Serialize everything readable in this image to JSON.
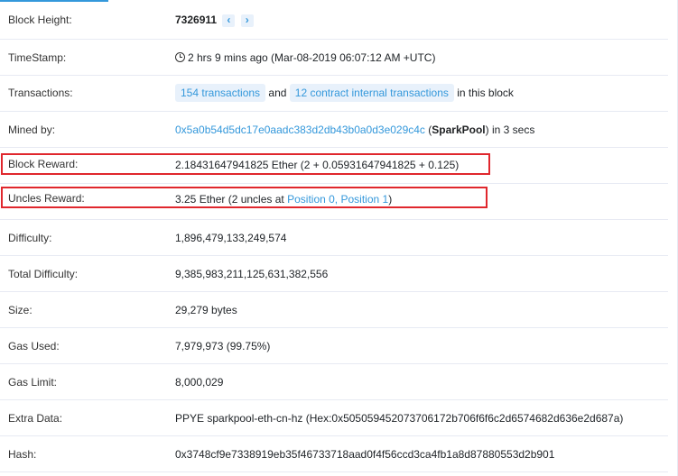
{
  "rows": {
    "block_height": {
      "label": "Block Height:",
      "value": "7326911"
    },
    "timestamp": {
      "label": "TimeStamp:",
      "value": "2 hrs 9 mins ago (Mar-08-2019 06:07:12 AM +UTC)"
    },
    "transactions": {
      "label": "Transactions:",
      "tx_badge": "154 transactions",
      "and": "and",
      "internal_badge": "12 contract internal transactions",
      "suffix": "in this block"
    },
    "mined_by": {
      "label": "Mined by:",
      "address": "0x5a0b54d5dc17e0aadc383d2db43b0a0d3e029c4c",
      "open_paren": "(",
      "pool": "SparkPool",
      "suffix": ") in 3 secs"
    },
    "block_reward": {
      "label": "Block Reward:",
      "value": "2.18431647941825 Ether (2 + 0.05931647941825 + 0.125)"
    },
    "uncles_reward": {
      "label": "Uncles Reward:",
      "prefix": "3.25 Ether (2 uncles at",
      "pos0": "Position 0,",
      "pos1": "Position 1",
      "suffix": ")"
    },
    "difficulty": {
      "label": "Difficulty:",
      "value": "1,896,479,133,249,574"
    },
    "total_difficulty": {
      "label": "Total Difficulty:",
      "value": "9,385,983,211,125,631,382,556"
    },
    "size": {
      "label": "Size:",
      "value": "29,279 bytes"
    },
    "gas_used": {
      "label": "Gas Used:",
      "value": "7,979,973 (99.75%)"
    },
    "gas_limit": {
      "label": "Gas Limit:",
      "value": "8,000,029"
    },
    "extra_data": {
      "label": "Extra Data:",
      "value": "PPYE sparkpool-eth-cn-hz (Hex:0x505059452073706172b706f6f6c2d6574682d636e2d687a)"
    },
    "hash": {
      "label": "Hash:",
      "value": "0x3748cf9e7338919eb35f46733718aad0f4f56ccd3ca4fb1a8d87880553d2b901"
    }
  },
  "icons": {
    "prev": "chevron-left-icon",
    "next": "chevron-right-icon",
    "clock": "clock-icon"
  },
  "colors": {
    "link": "#3498db",
    "highlight": "#e0272d",
    "badge_bg": "#e8f1fb"
  }
}
